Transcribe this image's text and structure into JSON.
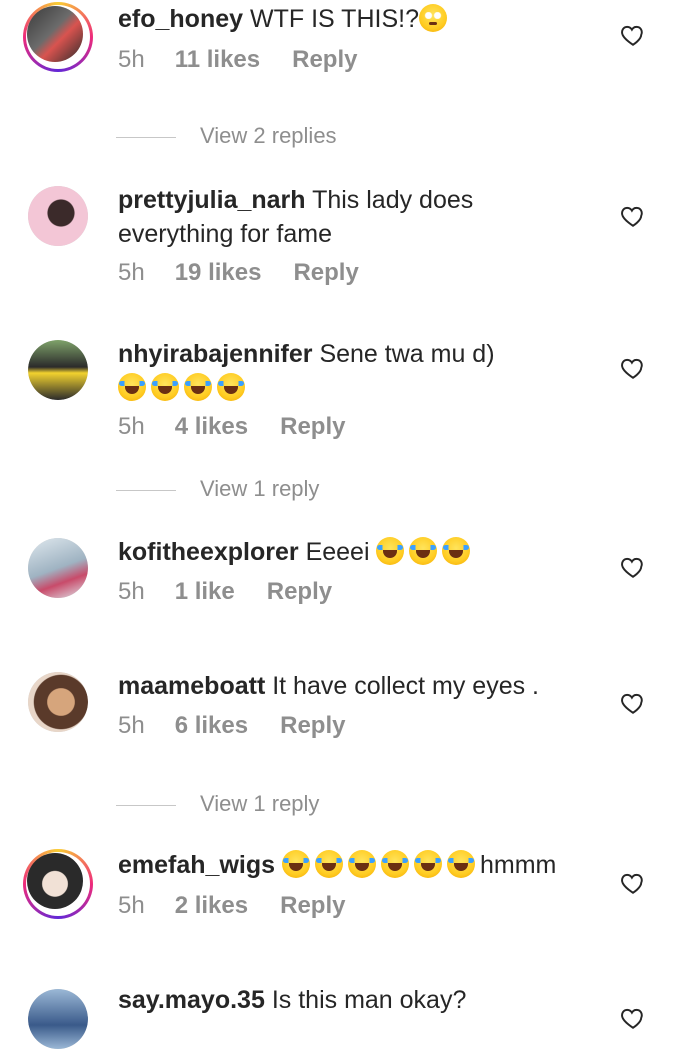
{
  "colors": {
    "text": "#262626",
    "meta": "#8e8e8e",
    "story_ring": [
      "#f9ce34",
      "#ee2a7b",
      "#6228d7"
    ]
  },
  "comments": [
    {
      "username": "efo_honey",
      "text": "WTF IS THIS!?",
      "emoji": [
        "flushed-face"
      ],
      "time": "5h",
      "likes": "11 likes",
      "reply": "Reply",
      "story": true,
      "avatar_colors": [
        "#2b2b2b",
        "#d9534f"
      ],
      "view_replies": "View 2 replies"
    },
    {
      "username": "prettyjulia_narh",
      "text": "This lady does everything for fame",
      "time": "5h",
      "likes": "19 likes",
      "reply": "Reply",
      "story": false,
      "avatar_colors": [
        "#f3c6d6",
        "#3b2a2a"
      ]
    },
    {
      "username": "nhyirabajennifer",
      "text": "Sene twa mu d)",
      "emoji": [
        "tears-of-joy",
        "tears-of-joy",
        "tears-of-joy",
        "tears-of-joy"
      ],
      "time": "5h",
      "likes": "4 likes",
      "reply": "Reply",
      "story": false,
      "avatar_colors": [
        "#7fa36a",
        "#f2d22e"
      ],
      "view_replies": "View 1 reply"
    },
    {
      "username": "kofitheexplorer",
      "text": "Eeeei",
      "emoji": [
        "tears-of-joy",
        "tears-of-joy",
        "tears-of-joy"
      ],
      "time": "5h",
      "likes": "1 like",
      "reply": "Reply",
      "story": false,
      "avatar_colors": [
        "#dfe8ee",
        "#c84b6a"
      ]
    },
    {
      "username": "maameboatt",
      "text": "It have collect my eyes .",
      "time": "5h",
      "likes": "6 likes",
      "reply": "Reply",
      "story": false,
      "avatar_colors": [
        "#d6a57c",
        "#5a3a2a"
      ],
      "view_replies": "View 1 reply"
    },
    {
      "username": "emefah_wigs",
      "text": "hmmm",
      "emoji_before_text": [
        "tears-of-joy",
        "tears-of-joy",
        "tears-of-joy",
        "tears-of-joy",
        "tears-of-joy",
        "tears-of-joy"
      ],
      "time": "5h",
      "likes": "2 likes",
      "reply": "Reply",
      "story": true,
      "avatar_colors": [
        "#e7e7e7",
        "#2a2a2a"
      ]
    },
    {
      "username": "say.mayo.35",
      "text": "Is this man okay?",
      "story": false,
      "avatar_colors": [
        "#9bb8d6",
        "#3a5a8a"
      ]
    }
  ]
}
